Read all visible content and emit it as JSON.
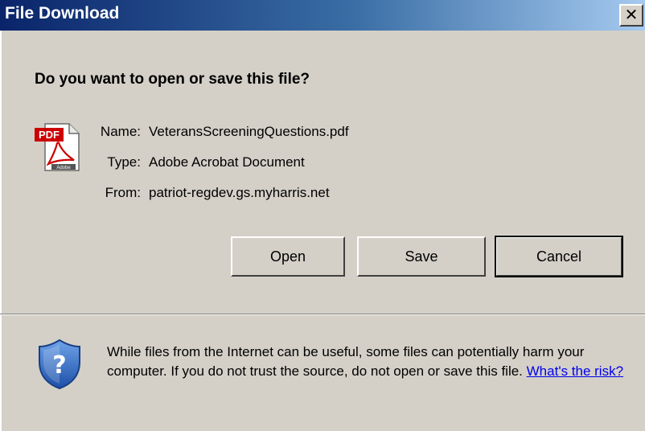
{
  "window": {
    "title": "File Download",
    "close_glyph": "✕"
  },
  "dialog": {
    "question": "Do you want to open or save this file?",
    "file_icon": "pdf-file-icon",
    "fields": [
      {
        "label": "Name:",
        "value": "VeteransScreeningQuestions.pdf"
      },
      {
        "label": "Type:",
        "value": "Adobe Acrobat Document"
      },
      {
        "label": "From:",
        "value": "patriot-regdev.gs.myharris.net"
      }
    ],
    "buttons": {
      "open": "Open",
      "save": "Save",
      "cancel": "Cancel"
    }
  },
  "warning": {
    "icon": "security-shield-question-icon",
    "text": "While files from the Internet can be useful, some files can potentially harm your computer. If you do not trust the source, do not open or save this file.",
    "link": "What's the risk?"
  },
  "colors": {
    "dialog_bg": "#d4d0c8",
    "titlebar_start": "#0a246a",
    "titlebar_end": "#a6caf0",
    "link": "#0000ee"
  }
}
